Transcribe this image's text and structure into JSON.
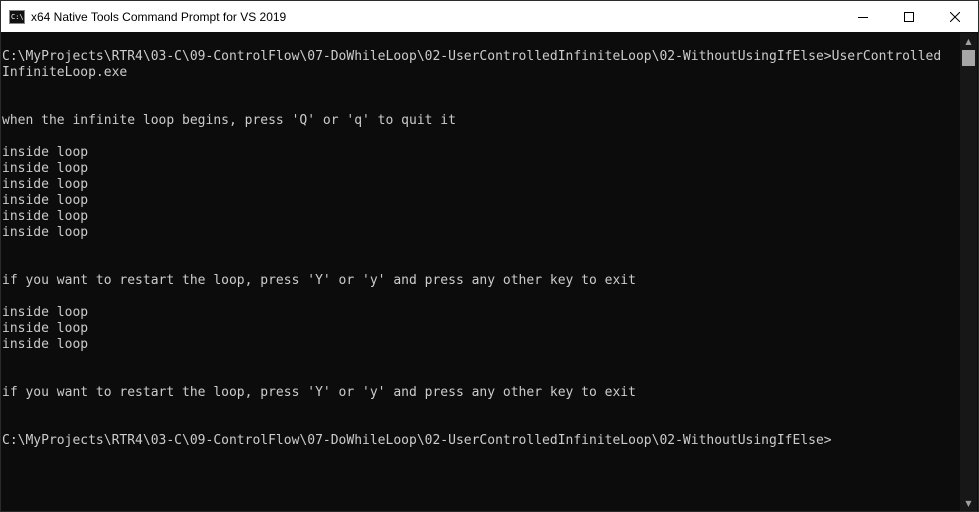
{
  "window": {
    "title": "x64 Native Tools Command Prompt for VS 2019",
    "icon_text": "C:\\."
  },
  "terminal": {
    "lines": [
      "",
      "C:\\MyProjects\\RTR4\\03-C\\09-ControlFlow\\07-DoWhileLoop\\02-UserControlledInfiniteLoop\\02-WithoutUsingIfElse>UserControlled",
      "InfiniteLoop.exe",
      "",
      "",
      "when the infinite loop begins, press 'Q' or 'q' to quit it",
      "",
      "inside loop",
      "inside loop",
      "inside loop",
      "inside loop",
      "inside loop",
      "inside loop",
      "",
      "",
      "if you want to restart the loop, press 'Y' or 'y' and press any other key to exit",
      "",
      "inside loop",
      "inside loop",
      "inside loop",
      "",
      "",
      "if you want to restart the loop, press 'Y' or 'y' and press any other key to exit",
      "",
      "",
      "C:\\MyProjects\\RTR4\\03-C\\09-ControlFlow\\07-DoWhileLoop\\02-UserControlledInfiniteLoop\\02-WithoutUsingIfElse>"
    ]
  },
  "colors": {
    "background": "#0c0c0c",
    "text": "#cccccc",
    "titlebar": "#ffffff"
  }
}
